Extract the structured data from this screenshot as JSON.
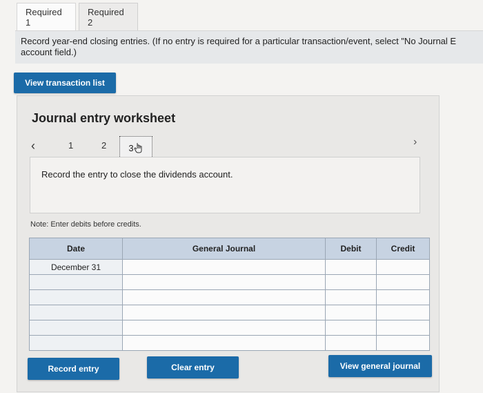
{
  "tabs": [
    {
      "label": "Required 1"
    },
    {
      "label": "Required 2"
    }
  ],
  "instruction": {
    "line1": "Record year-end closing entries. (If no entry is required for a particular transaction/event, select \"No Journal E",
    "line2": "account field.)"
  },
  "buttons": {
    "view_transaction_list": "View transaction list",
    "record_entry": "Record entry",
    "clear_entry": "Clear entry",
    "view_general_journal": "View general journal"
  },
  "worksheet": {
    "title": "Journal entry worksheet",
    "pages": [
      "1",
      "2",
      "3"
    ],
    "current_page": "3",
    "prompt": "Record the entry to close the dividends account.",
    "note": "Note: Enter debits before credits."
  },
  "table": {
    "headers": [
      "Date",
      "General Journal",
      "Debit",
      "Credit"
    ],
    "rows": [
      [
        "December 31",
        "",
        "",
        ""
      ],
      [
        "",
        "",
        "",
        ""
      ],
      [
        "",
        "",
        "",
        ""
      ],
      [
        "",
        "",
        "",
        ""
      ],
      [
        "",
        "",
        "",
        ""
      ],
      [
        "",
        "",
        "",
        ""
      ]
    ]
  },
  "colors": {
    "primary_button": "#1b6ba8",
    "table_header": "#c7d3e2"
  },
  "icons": {
    "prev": "chevron-left-icon",
    "next": "chevron-right-icon",
    "cursor": "hand-pointer-icon"
  }
}
